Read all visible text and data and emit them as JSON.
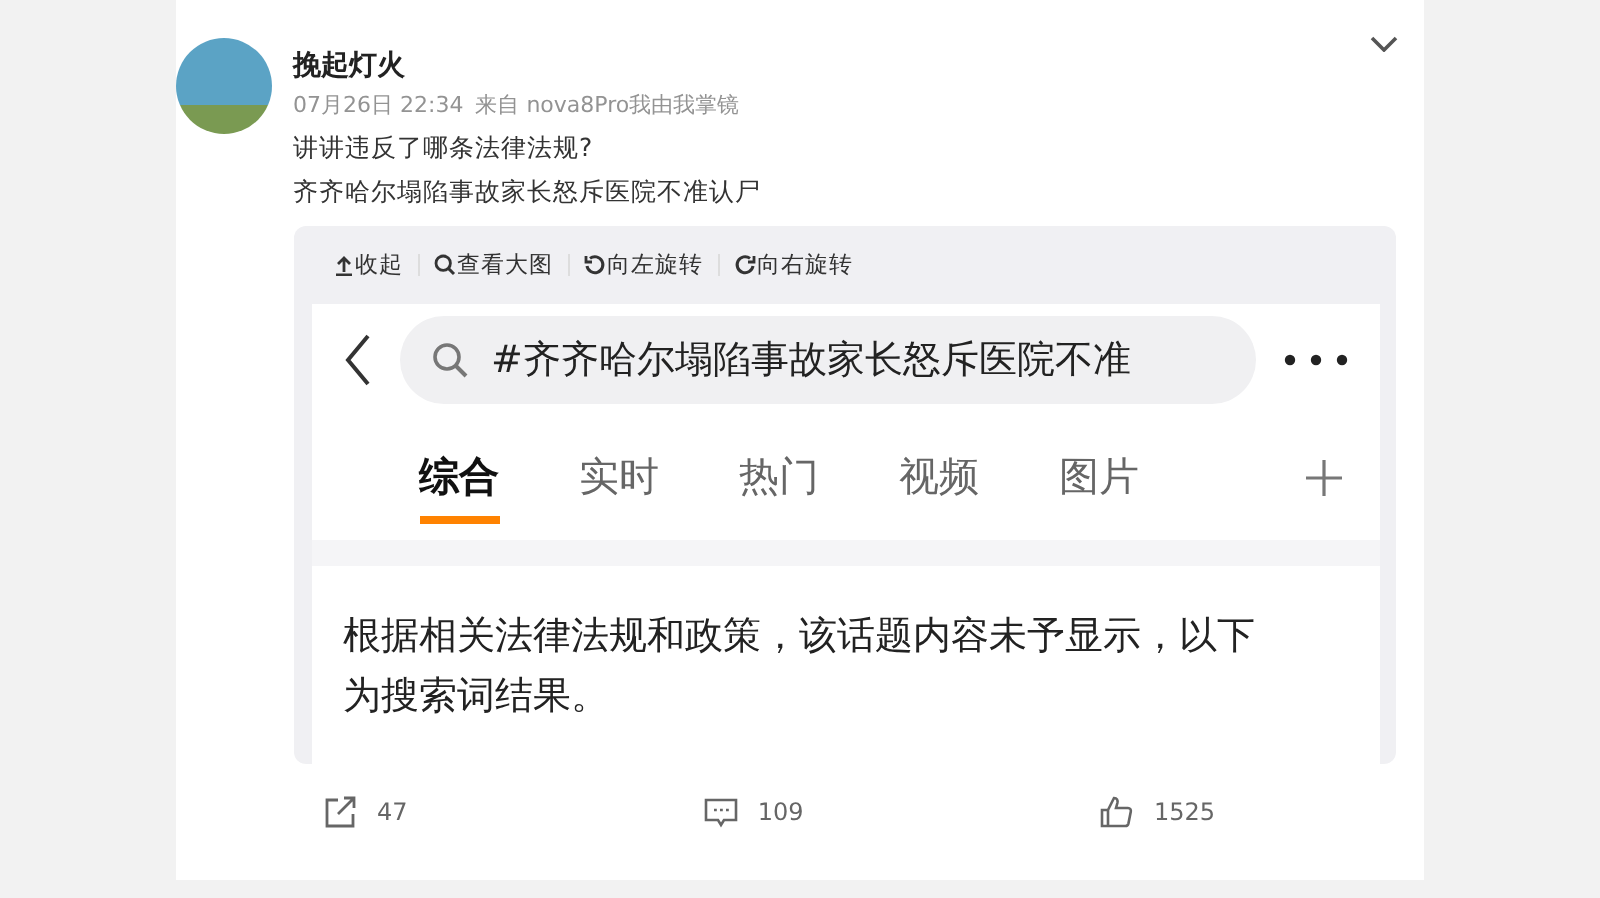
{
  "post": {
    "author": "挽起灯火",
    "date": "07月26日 22:34",
    "source": "来自 nova8Pro我由我掌镜",
    "texts": [
      "讲讲违反了哪条法律法规?",
      "齐齐哈尔塌陷事故家长怒斥医院不准认尸"
    ],
    "image_toolbar": [
      {
        "kind": "collapse",
        "label": "收起"
      },
      {
        "kind": "zoom",
        "label": "查看大图"
      },
      {
        "kind": "rotate-left",
        "label": "向左旋转"
      },
      {
        "kind": "rotate-right",
        "label": "向右旋转"
      }
    ],
    "screenshot": {
      "search_query": "#齐齐哈尔塌陷事故家长怒斥医院不准",
      "tabs": [
        {
          "label": "综合",
          "selected": true
        },
        {
          "label": "实时",
          "selected": false
        },
        {
          "label": "热门",
          "selected": false
        },
        {
          "label": "视频",
          "selected": false
        },
        {
          "label": "图片",
          "selected": false
        }
      ],
      "notice": "根据相关法律法规和政策，该话题内容未予显示，以下为搜索词结果。"
    },
    "actions": [
      {
        "kind": "repost",
        "count": "47"
      },
      {
        "kind": "comment",
        "count": "109"
      },
      {
        "kind": "like",
        "count": "1525"
      }
    ]
  }
}
